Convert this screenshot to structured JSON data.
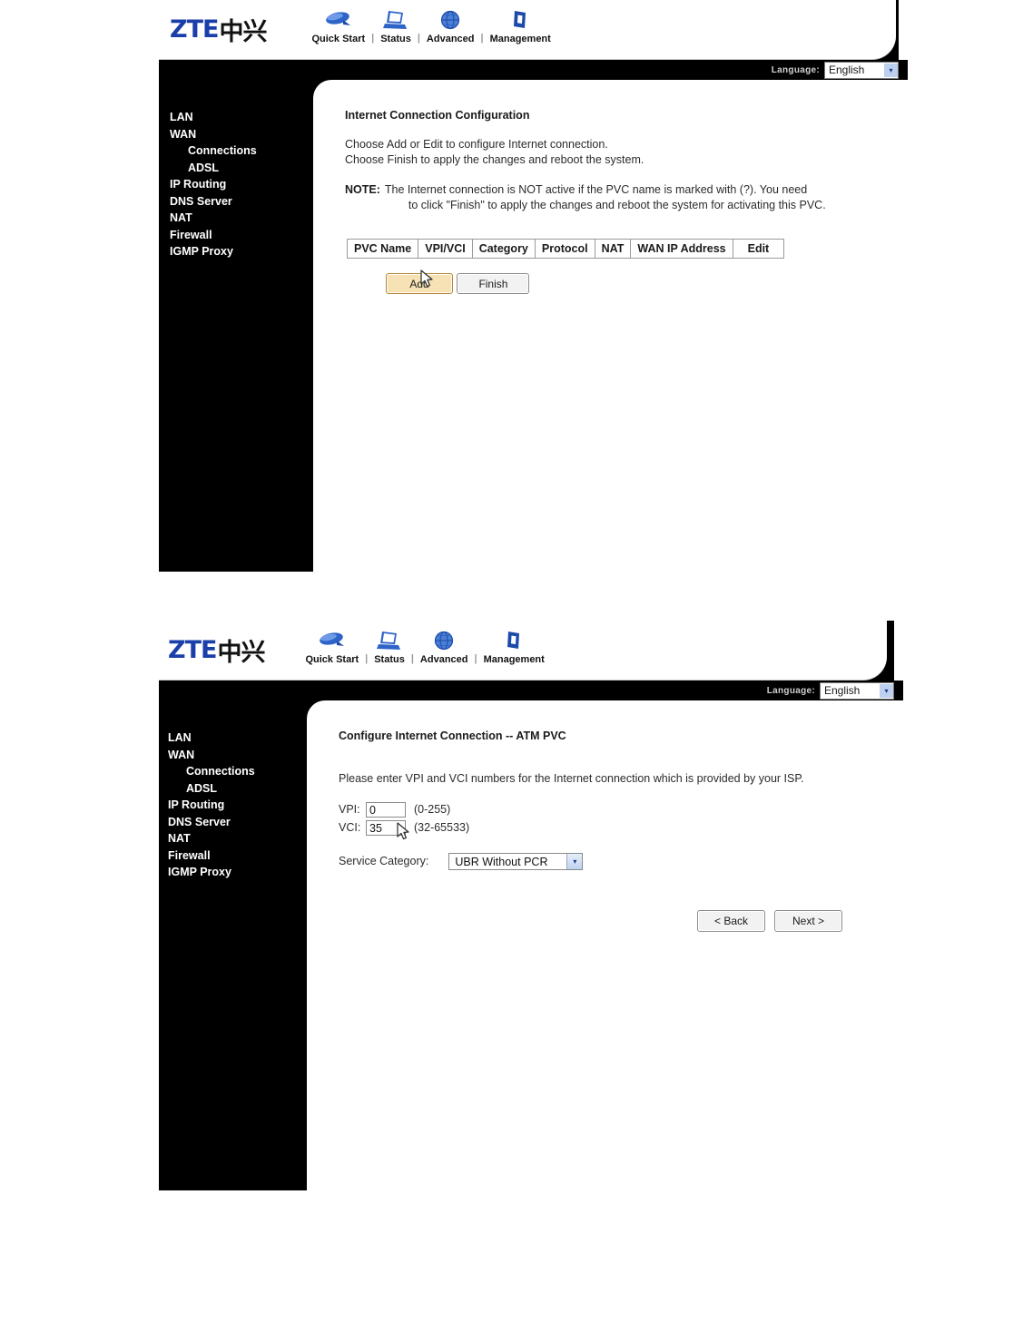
{
  "brand": {
    "latin": "ZTE",
    "cjk": "中兴"
  },
  "topnav": {
    "separator": "|",
    "items": [
      {
        "label": "Quick Start",
        "icon": "phone-icon"
      },
      {
        "label": "Status",
        "icon": "laptop-icon"
      },
      {
        "label": "Advanced",
        "icon": "globe-icon"
      },
      {
        "label": "Management",
        "icon": "folder-icon"
      }
    ]
  },
  "language": {
    "label": "Language:",
    "selected": "English",
    "arrow": "▾"
  },
  "sidebar": {
    "items": [
      {
        "label": "LAN",
        "sub": false
      },
      {
        "label": "WAN",
        "sub": false
      },
      {
        "label": "Connections",
        "sub": true
      },
      {
        "label": "ADSL",
        "sub": true
      },
      {
        "label": "IP Routing",
        "sub": false
      },
      {
        "label": "DNS Server",
        "sub": false
      },
      {
        "label": "NAT",
        "sub": false
      },
      {
        "label": "Firewall",
        "sub": false
      },
      {
        "label": "IGMP Proxy",
        "sub": false
      }
    ]
  },
  "panel1": {
    "title": "Internet Connection Configuration",
    "line1": "Choose Add or Edit to configure Internet connection.",
    "line2": "Choose Finish to apply the changes and reboot the system.",
    "note_label": "NOTE:",
    "note_line1": "The Internet connection is NOT active if the PVC name is marked with (?). You need",
    "note_line2": "to click \"Finish\" to apply the changes and reboot the system for activating this PVC.",
    "table": {
      "headers": [
        "PVC Name",
        "VPI/VCI",
        "Category",
        "Protocol",
        "NAT",
        "WAN IP Address",
        "Edit"
      ],
      "rows": []
    },
    "add_button": "Add",
    "finish_button": "Finish"
  },
  "panel2": {
    "title": "Configure Internet Connection -- ATM PVC",
    "description": "Please enter VPI and VCI numbers for the Internet connection which is provided by your ISP.",
    "vpi": {
      "label": "VPI:",
      "value": "0",
      "range": "(0-255)"
    },
    "vci": {
      "label": "VCI:",
      "value": "35",
      "range": "(32-65533)"
    },
    "service_category": {
      "label": "Service Category:",
      "selected": "UBR Without PCR",
      "arrow": "▾"
    },
    "back_button": "< Back",
    "next_button": "Next >"
  },
  "colors": {
    "brand_blue": "#1b3faa",
    "icon_blue": "#2e63c8",
    "chrome_black": "#000000",
    "hover_tan": "#f6e2b4"
  }
}
